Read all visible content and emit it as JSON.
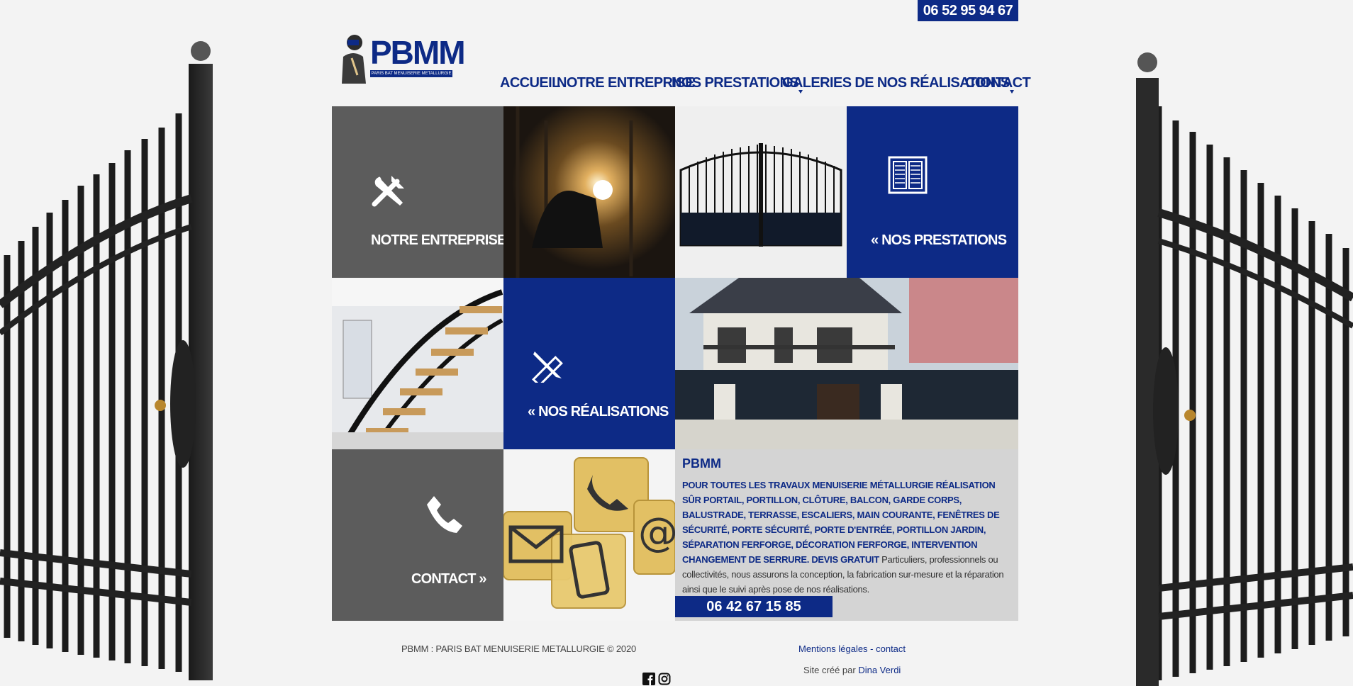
{
  "header": {
    "phone": "06 52 95 94 67",
    "logo_text": "PBMM",
    "logo_sub": "PARIS BAT MENUISERIE METALLURGIE"
  },
  "nav": {
    "items": [
      {
        "label": "ACCUEIL"
      },
      {
        "label": "NOTRE ENTREPRISE"
      },
      {
        "label": "NOS PRESTATIONS"
      },
      {
        "label": "GALERIES DE NOS RÉALISATIONS"
      },
      {
        "label": "CONTACT"
      }
    ]
  },
  "tiles": {
    "entreprise_label": "NOTRE ENTREPRISE »",
    "prestations_label": "« NOS PRESTATIONS",
    "realisations_label": "« NOS RÉALISATIONS",
    "contact_label": "CONTACT »"
  },
  "info": {
    "title": "PBMM",
    "bold_text": "POUR TOUTES LES TRAVAUX MENUISERIE MÉTALLURGIE RÉALISATION SÛR PORTAIL, PORTILLON, CLÔTURE, BALCON, GARDE CORPS, BALUSTRADE, TERRASSE, ESCALIERS, MAIN COURANTE, FENÊTRES DE SÉCURITÉ, PORTE SÉCURITÉ, PORTE D'ENTRÉE, PORTILLON JARDIN, SÉPARATION FERFORGE, DÉCORATION FERFORGE, INTERVENTION CHANGEMENT DE SERRURE. DEVIS GRATUIT",
    "plain_text": " Particuliers, professionnels ou collectivités, nous assurons la conception, la fabrication sur-mesure et la réparation ainsi que le suivi après pose de nos réalisations.",
    "phone": "06 42 67 15 85"
  },
  "footer": {
    "copyright": "PBMM : PARIS BAT MENUISERIE METALLURGIE © 2020",
    "legal": "Mentions légales - contact",
    "credit_prefix": "Site créé par ",
    "credit_name": "Dina Verdi"
  },
  "colors": {
    "brand_blue": "#0d2a86",
    "tile_gray": "#5c5c5c",
    "background": "#f3f3f3"
  },
  "icons": {
    "entreprise": "hammer-wrench-icon",
    "prestations": "window-shutter-icon",
    "realisations": "pencil-ruler-icon",
    "contact": "phone-icon",
    "social": [
      "facebook-icon",
      "instagram-icon"
    ]
  }
}
